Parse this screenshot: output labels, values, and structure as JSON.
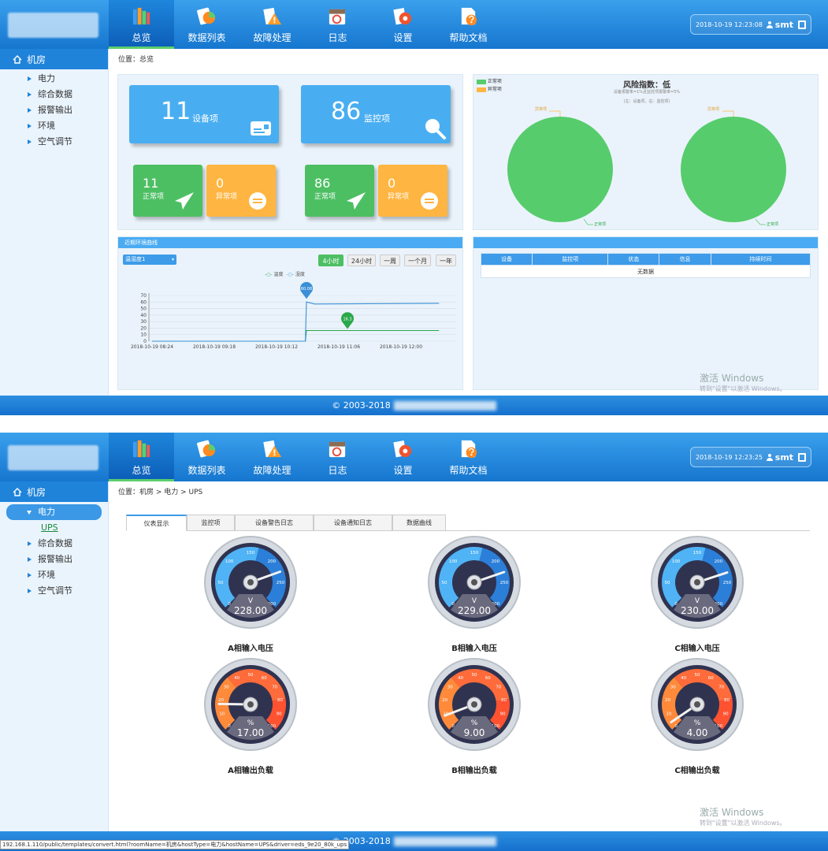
{
  "panel1": {
    "header": {
      "nav": [
        {
          "label": "总览",
          "icon": "books-icon",
          "active": true
        },
        {
          "label": "数据列表",
          "icon": "chart-list-icon",
          "active": false
        },
        {
          "label": "故障处理",
          "icon": "warning-icon",
          "active": false
        },
        {
          "label": "日志",
          "icon": "calendar-icon",
          "active": false
        },
        {
          "label": "设置",
          "icon": "gear-icon",
          "active": false
        },
        {
          "label": "帮助文档",
          "icon": "help-doc-icon",
          "active": false
        }
      ],
      "datetime": "2018-10-19  12:23:08",
      "user": "smt"
    },
    "sidebar": {
      "head": "机房",
      "items": [
        "电力",
        "综合数据",
        "报警输出",
        "环境",
        "空气调节"
      ]
    },
    "breadcrumb": "位置：总览",
    "summary": {
      "device": {
        "count": "11",
        "label": "设备项",
        "normal": "11",
        "normal_label": "正常项",
        "abnormal": "0",
        "abnormal_label": "异常项"
      },
      "monitor": {
        "count": "86",
        "label": "监控项",
        "normal": "86",
        "normal_label": "正常项",
        "abnormal": "0",
        "abnormal_label": "异常项"
      }
    },
    "risk": {
      "title": "风险指数：低",
      "sub1": "设备报警率=1%且监控项报警率=5%",
      "sub2": "(左：设备项，右：监控项)",
      "legend_normal": "正常项",
      "legend_abnormal": "异常项",
      "pie_label_abnormal": "异常项",
      "pie_label_normal": "正常项",
      "colors": {
        "normal": "#57cc6c",
        "abnormal": "#ffb541"
      }
    },
    "env_chart": {
      "bar_title": "近期环境曲线",
      "select_value": "温湿度1",
      "ranges": [
        "4小时",
        "24小时",
        "一周",
        "一个月",
        "一年"
      ],
      "active_range": "4小时",
      "legend": [
        "温度",
        "湿度"
      ],
      "callout_high": "60.08",
      "callout_low": "16.3"
    },
    "alarm_table": {
      "headers": [
        "设备",
        "监控项",
        "状态",
        "信息",
        "持续时间"
      ],
      "empty": "无数据"
    },
    "watermark": {
      "title": "激活 Windows",
      "sub": "转到\"设置\"以激活 Windows。"
    },
    "footer": "© 2003-2018"
  },
  "panel2": {
    "header": {
      "nav": [
        {
          "label": "总览",
          "icon": "books-icon",
          "active": true
        },
        {
          "label": "数据列表",
          "icon": "chart-list-icon",
          "active": false
        },
        {
          "label": "故障处理",
          "icon": "warning-icon",
          "active": false
        },
        {
          "label": "日志",
          "icon": "calendar-icon",
          "active": false
        },
        {
          "label": "设置",
          "icon": "gear-icon",
          "active": false
        },
        {
          "label": "帮助文档",
          "icon": "help-doc-icon",
          "active": false
        }
      ],
      "datetime": "2018-10-19  12:23:25",
      "user": "smt"
    },
    "sidebar": {
      "head": "机房",
      "open_item": "电力",
      "sub_item": "UPS",
      "items": [
        "综合数据",
        "报警输出",
        "环境",
        "空气调节"
      ]
    },
    "breadcrumb": "位置：机房 > 电力 > UPS",
    "tabs": [
      "仪表显示",
      "监控项",
      "设备警告日志",
      "设备通知日志",
      "数据曲线"
    ],
    "active_tab": "仪表显示",
    "gauges": [
      {
        "title": "A相输入电压",
        "unit": "V",
        "value": 228.0,
        "display": "228.00",
        "max": 300,
        "ticks": [
          "0",
          "50",
          "100",
          "150",
          "200",
          "250",
          "300"
        ],
        "theme": "blue"
      },
      {
        "title": "B相输入电压",
        "unit": "V",
        "value": 229.0,
        "display": "229.00",
        "max": 300,
        "ticks": [
          "0",
          "50",
          "100",
          "150",
          "200",
          "250",
          "300"
        ],
        "theme": "blue"
      },
      {
        "title": "C相输入电压",
        "unit": "V",
        "value": 230.0,
        "display": "230.00",
        "max": 300,
        "ticks": [
          "0",
          "50",
          "100",
          "150",
          "200",
          "250",
          "300"
        ],
        "theme": "blue"
      },
      {
        "title": "A相输出负载",
        "unit": "%",
        "value": 17.0,
        "display": "17.00",
        "max": 100,
        "ticks": [
          "0",
          "10",
          "20",
          "30",
          "40",
          "50",
          "60",
          "70",
          "80",
          "90",
          "100"
        ],
        "theme": "orange"
      },
      {
        "title": "B相输出负载",
        "unit": "%",
        "value": 9.0,
        "display": "9.00",
        "max": 100,
        "ticks": [
          "0",
          "10",
          "20",
          "30",
          "40",
          "50",
          "60",
          "70",
          "80",
          "90",
          "100"
        ],
        "theme": "orange"
      },
      {
        "title": "C相输出负载",
        "unit": "%",
        "value": 4.0,
        "display": "4.00",
        "max": 100,
        "ticks": [
          "0",
          "10",
          "20",
          "30",
          "40",
          "50",
          "60",
          "70",
          "80",
          "90",
          "100"
        ],
        "theme": "orange"
      }
    ],
    "status_url": "192.168.1.110/public/templates/convert.html?roomName=机房&hostType=电力&hostName=UPS&driver=eds_9e20_80k_ups",
    "watermark": {
      "title": "激活 Windows",
      "sub": "转到\"设置\"以激活 Windows。"
    },
    "footer": "© 2003-2018"
  },
  "chart_data": {
    "type": "line",
    "title": "近期环境曲线",
    "xlabel": "",
    "ylabel": "",
    "x": [
      "2018-10-19 08:24",
      "2018-10-19 09:18",
      "2018-10-19 10:12",
      "2018-10-19 11:06",
      "2018-10-19 12:00"
    ],
    "ylim": [
      0,
      70
    ],
    "yticks": [
      0,
      10,
      20,
      30,
      40,
      50,
      60,
      70
    ],
    "series": [
      {
        "name": "温度",
        "color": "#2aa84a",
        "points": [
          [
            "2018-10-19 08:24",
            0
          ],
          [
            "2018-10-19 10:37",
            0
          ],
          [
            "2018-10-19 10:38",
            16.3
          ],
          [
            "2018-10-19 12:33",
            16.3
          ]
        ]
      },
      {
        "name": "湿度",
        "color": "#3b8fd6",
        "points": [
          [
            "2018-10-19 08:24",
            0
          ],
          [
            "2018-10-19 10:37",
            0
          ],
          [
            "2018-10-19 10:38",
            60.08
          ],
          [
            "2018-10-19 10:45",
            57
          ],
          [
            "2018-10-19 12:33",
            58
          ]
        ]
      }
    ],
    "grid": true,
    "legend": "top-center"
  }
}
